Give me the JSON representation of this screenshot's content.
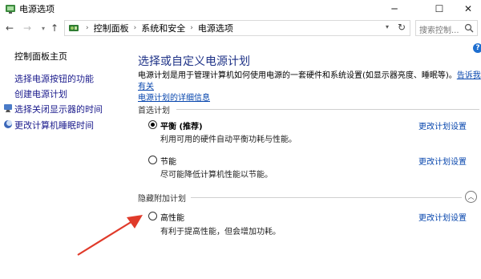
{
  "window": {
    "title": "电源选项"
  },
  "titlebar": {
    "minimize": "─",
    "maximize": "☐",
    "close": "✕"
  },
  "nav": {
    "back": "←",
    "forward": "→",
    "dropdown": "▾",
    "up": "↑",
    "breadcrumb": [
      "控制面板",
      "系统和安全",
      "电源选项"
    ],
    "breadcrumb_sep": "›",
    "addr_dropdown": "▾",
    "refresh": "↻",
    "search_placeholder": "搜索控制..."
  },
  "sidebar": {
    "home": "控制面板主页",
    "items": [
      {
        "label": "选择电源按钮的功能"
      },
      {
        "label": "创建电源计划"
      },
      {
        "label": "选择关闭显示器的时间"
      },
      {
        "label": "更改计算机睡眠时间"
      }
    ]
  },
  "main": {
    "help": "?",
    "title": "选择或自定义电源计划",
    "desc_text": "电源计划是用于管理计算机如何使用电源的一套硬件和系统设置(如显示器亮度、睡眠等)。",
    "desc_link1": "告诉我有关",
    "desc_link2": "电源计划的详细信息",
    "preferred_label": "首选计划",
    "hidden_label": "隐藏附加计划",
    "collapse": "︿",
    "plans": [
      {
        "name": "平衡 (推荐)",
        "desc": "利用可用的硬件自动平衡功耗与性能。",
        "link": "更改计划设置",
        "selected": true
      },
      {
        "name": "节能",
        "desc": "尽可能降低计算机性能以节能。",
        "link": "更改计划设置",
        "selected": false
      },
      {
        "name": "高性能",
        "desc": "有利于提高性能，但会增加功耗。",
        "link": "更改计划设置",
        "selected": false
      }
    ]
  },
  "colors": {
    "title": "#1e3287",
    "link": "#0645ad",
    "arrow": "#e03a2a"
  }
}
